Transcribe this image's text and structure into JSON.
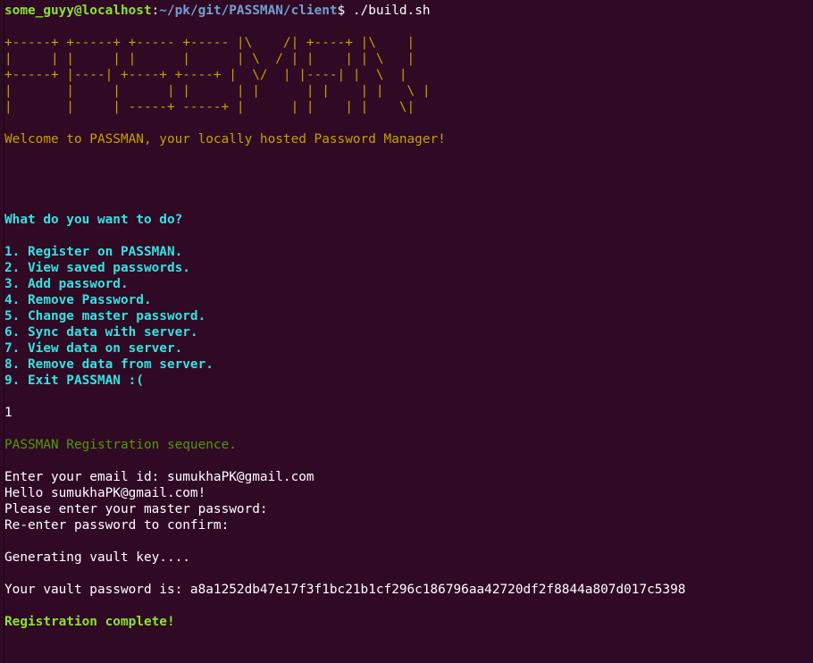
{
  "prompt": {
    "user_host": "some_guyy@localhost",
    "colon": ":",
    "path": "~/pk/git/PASSMAN/client",
    "dollar": "$",
    "command": " ./build.sh"
  },
  "banner": [
    "+-----+ +-----+ +----- +----- |\\    /| +----+ |\\    |",
    "|     | |     | |      |      | \\  / | |    | | \\   |",
    "+-----+ |----| +----+ +----+ |  \\/  | |----| |  \\  |",
    "|       |     |      | |      | |      | |    | |   \\ |",
    "|       |     | -----+ -----+ |      | |    | |    \\|"
  ],
  "welcome": "Welcome to PASSMAN, your locally hosted Password Manager!",
  "menu": {
    "question": "What do you want to do?",
    "options": [
      "1. Register on PASSMAN.",
      "2. View saved passwords.",
      "3. Add password.",
      "4. Remove Password.",
      "5. Change master password.",
      "6. Sync data with server.",
      "7. View data on server.",
      "8. Remove data from server.",
      "9. Exit PASSMAN :("
    ]
  },
  "choice": "1",
  "registration": {
    "heading": "PASSMAN Registration sequence.",
    "email_prompt": "Enter your email id: sumukhaPK@gmail.com",
    "hello": "Hello sumukhaPK@gmail.com!",
    "master_prompt": "Please enter your master password:",
    "reenter_prompt": "Re-enter password to confirm:",
    "generating": "Generating vault key....",
    "vault_password": "Your vault password is: a8a1252db47e17f3f1bc21b1cf296c186796aa42720df2f8844a807d017c5398",
    "complete": "Registration complete!"
  },
  "colors": {
    "background": "#300a24",
    "prompt_user": "#8ae234",
    "prompt_path": "#729fcf",
    "banner": "#c4a000",
    "menu": "#34e2e2",
    "registration_heading": "#4e9a06",
    "complete": "#8ae234"
  }
}
